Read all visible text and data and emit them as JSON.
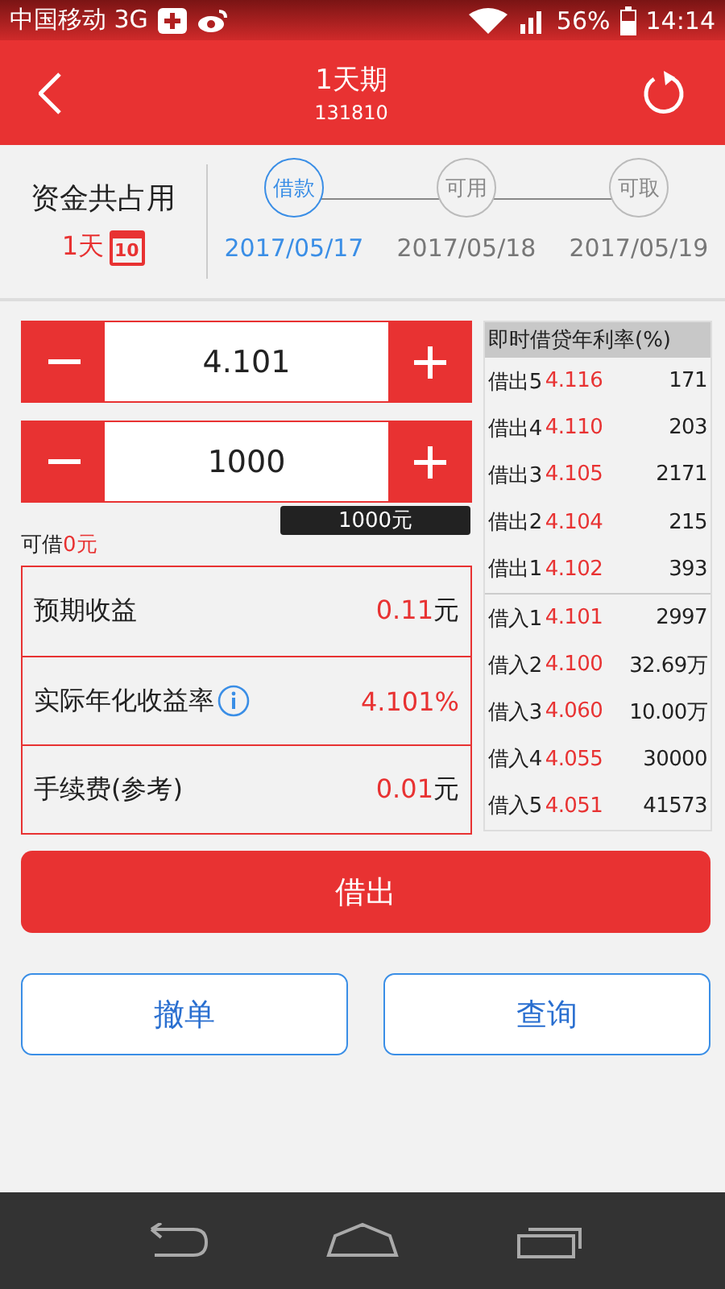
{
  "status_bar": {
    "carrier": "中国移动 3G",
    "battery": "56%",
    "time": "14:14"
  },
  "header": {
    "title": "1天期",
    "code": "131810"
  },
  "summary": {
    "label": "资金共占用",
    "days": "1天",
    "calendar_day": "10"
  },
  "steps": [
    {
      "label": "借款",
      "date": "2017/05/17",
      "selected": true
    },
    {
      "label": "可用",
      "date": "2017/05/18",
      "selected": false
    },
    {
      "label": "可取",
      "date": "2017/05/19",
      "selected": false
    }
  ],
  "steppers": [
    {
      "value": "4.101"
    },
    {
      "value": "1000",
      "tooltip": "1000元"
    }
  ],
  "available": {
    "label": "可借",
    "amount": "0元"
  },
  "results": [
    {
      "label": "预期收益",
      "value": "0.11",
      "unit": "元",
      "info": false
    },
    {
      "label": "实际年化收益率",
      "value": "4.101%",
      "info": true
    },
    {
      "label": "手续费(参考)",
      "value": "0.01",
      "unit": "元",
      "info": false
    }
  ],
  "quotes": {
    "title": "即时借贷年利率(%)",
    "asks": [
      {
        "label": "借出5",
        "rate": "4.116",
        "volume": "171"
      },
      {
        "label": "借出4",
        "rate": "4.110",
        "volume": "203"
      },
      {
        "label": "借出3",
        "rate": "4.105",
        "volume": "2171"
      },
      {
        "label": "借出2",
        "rate": "4.104",
        "volume": "215"
      },
      {
        "label": "借出1",
        "rate": "4.102",
        "volume": "393"
      }
    ],
    "bids": [
      {
        "label": "借入1",
        "rate": "4.101",
        "volume": "2997"
      },
      {
        "label": "借入2",
        "rate": "4.100",
        "volume": "32.69万"
      },
      {
        "label": "借入3",
        "rate": "4.060",
        "volume": "10.00万"
      },
      {
        "label": "借入4",
        "rate": "4.055",
        "volume": "30000"
      },
      {
        "label": "借入5",
        "rate": "4.051",
        "volume": "41573"
      }
    ]
  },
  "primary_button": "借出",
  "secondary_buttons": [
    "撤单",
    "查询"
  ]
}
